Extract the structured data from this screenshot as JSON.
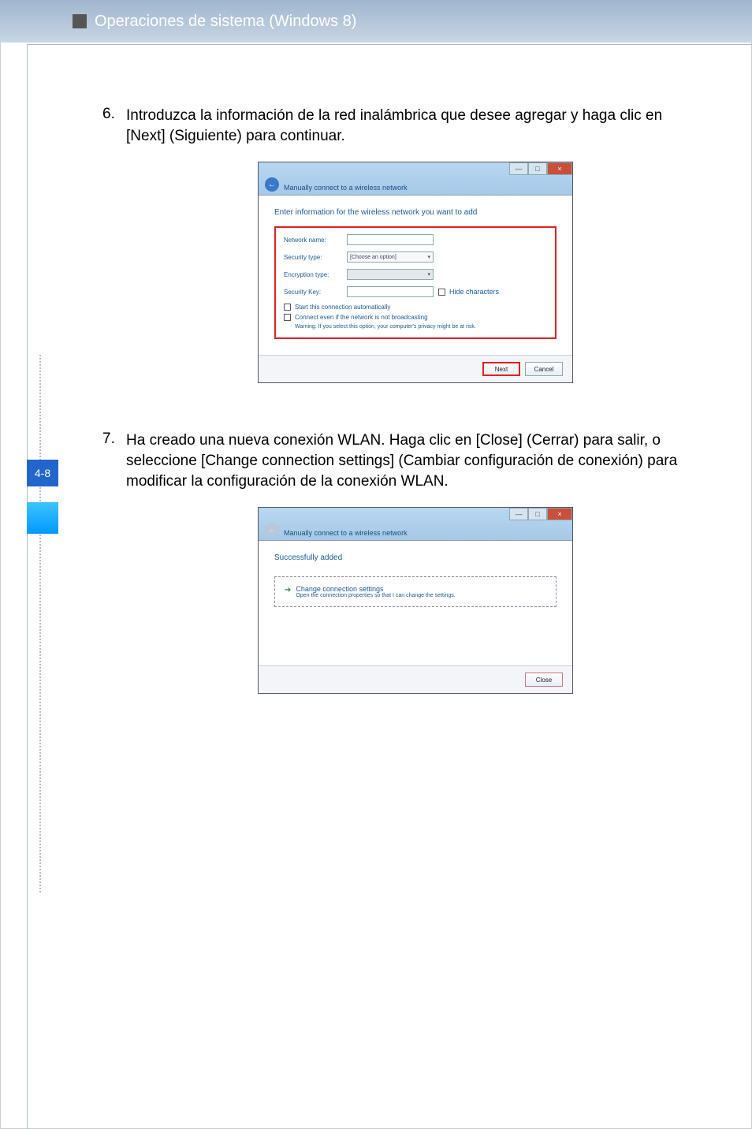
{
  "header": {
    "title": "Operaciones de sistema (Windows 8)"
  },
  "page_number": "4-8",
  "steps": [
    {
      "num": "6.",
      "text": "Introduzca la información de la red inalámbrica que desee agregar y haga clic en [Next] (Siguiente) para continuar."
    },
    {
      "num": "7.",
      "text": "Ha creado una nueva conexión WLAN. Haga clic en [Close] (Cerrar) para salir, o seleccione [Change connection settings] (Cambiar configuración de conexión) para modificar la configuración de la conexión WLAN."
    }
  ],
  "dialog1": {
    "titlebar": "Manually connect to a wireless network",
    "heading": "Enter information for the wireless network you want to add",
    "labels": {
      "network_name": "Network name:",
      "security_type": "Security type:",
      "encryption_type": "Encryption type:",
      "security_key": "Security Key:"
    },
    "values": {
      "network_name": "",
      "security_type": "[Choose an option]",
      "encryption_type": "",
      "security_key": ""
    },
    "hide_chars": "Hide characters",
    "checkbox1": "Start this connection automatically",
    "checkbox2": "Connect even if the network is not broadcasting",
    "warning": "Warning: If you select this option, your computer's privacy might be at risk.",
    "buttons": {
      "next": "Next",
      "cancel": "Cancel"
    },
    "win_close": "×",
    "win_min": "—",
    "win_max": "□"
  },
  "dialog2": {
    "titlebar": "Manually connect to a wireless network",
    "heading": "Successfully added",
    "change_title": "Change connection settings",
    "change_sub": "Open the connection properties so that I can change the settings.",
    "buttons": {
      "close": "Close"
    },
    "win_close": "×",
    "win_min": "—",
    "win_max": "□"
  }
}
